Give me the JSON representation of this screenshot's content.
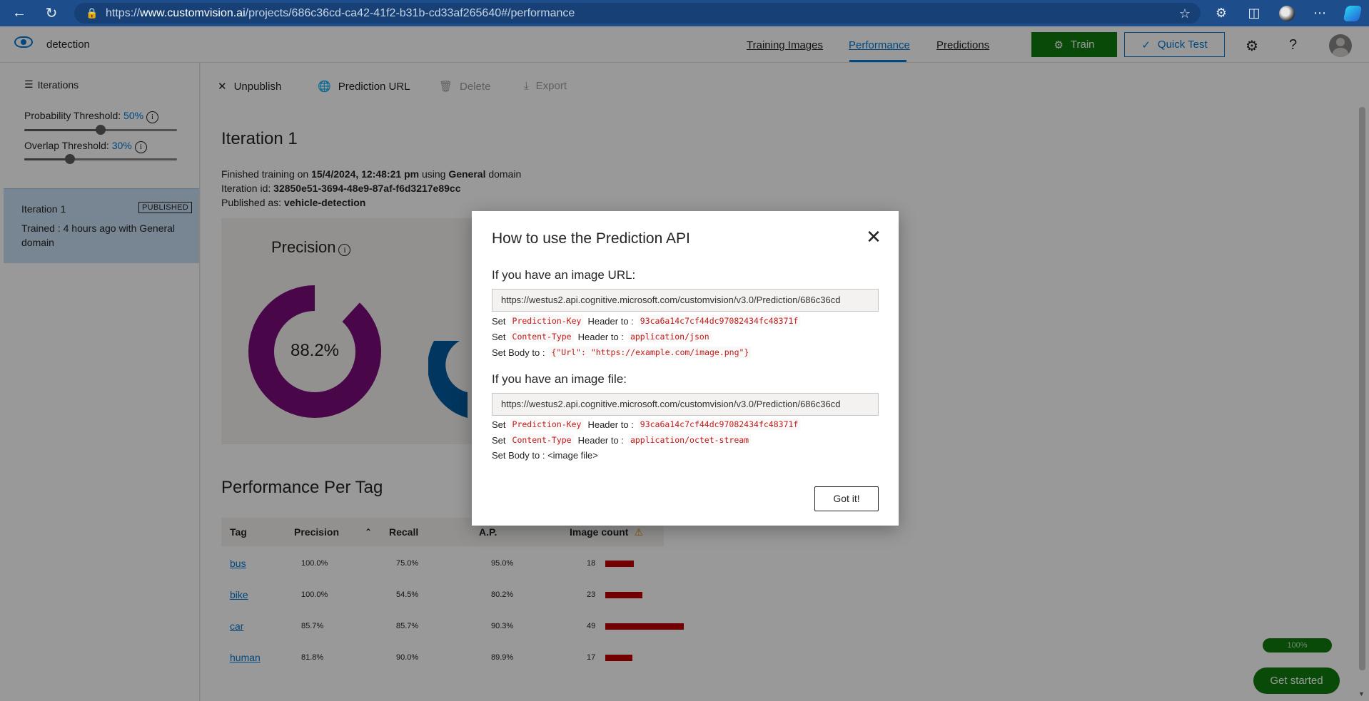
{
  "browser": {
    "url_prefix": "https://",
    "url_host": "www.customvision.ai",
    "url_path": "/projects/686c36cd-ca42-41f2-b31b-cd33af265640#/performance"
  },
  "header": {
    "project_name": "detection",
    "nav": [
      "Training Images",
      "Performance",
      "Predictions"
    ],
    "train_label": "Train",
    "quick_test_label": "Quick Test"
  },
  "sidebar": {
    "iterations_label": "Iterations",
    "probability_label": "Probability Threshold:",
    "probability_value": "50%",
    "probability_level": 0.5,
    "overlap_label": "Overlap Threshold:",
    "overlap_value": "30%",
    "overlap_level": 0.3,
    "iteration": {
      "title": "Iteration 1",
      "badge": "PUBLISHED",
      "desc": "Trained : 4 hours ago with General domain"
    }
  },
  "toolbar": {
    "unpublish": "Unpublish",
    "prediction_url": "Prediction URL",
    "delete": "Delete",
    "export": "Export"
  },
  "main": {
    "title": "Iteration 1",
    "finished_prefix": "Finished training on",
    "finished_date": "15/4/2024, 12:48:21 pm",
    "finished_using": "using",
    "domain": "General",
    "domain_suffix": "domain",
    "iteration_id_label": "Iteration id:",
    "iteration_id": "32850e51-3694-48e9-87af-f6d3217e89cc",
    "published_label": "Published as:",
    "published_name": "vehicle-detection",
    "precision_title": "Precision",
    "precision_value": "88.2%",
    "precision_level": 0.882,
    "perf_title": "Performance Per Tag"
  },
  "table": {
    "headers": [
      "Tag",
      "Precision",
      "Recall",
      "A.P.",
      "Image count"
    ],
    "rows": [
      {
        "tag": "bus",
        "precision": "100.0%",
        "recall": "75.0%",
        "ap": "95.0%",
        "count": "18",
        "count_num": 18
      },
      {
        "tag": "bike",
        "precision": "100.0%",
        "recall": "54.5%",
        "ap": "80.2%",
        "count": "23",
        "count_num": 23
      },
      {
        "tag": "car",
        "precision": "85.7%",
        "recall": "85.7%",
        "ap": "90.3%",
        "count": "49",
        "count_num": 49
      },
      {
        "tag": "human",
        "precision": "81.8%",
        "recall": "90.0%",
        "ap": "89.9%",
        "count": "17",
        "count_num": 17
      }
    ]
  },
  "dialog": {
    "title": "How to use the Prediction API",
    "url_heading": "If you have an image URL:",
    "file_heading": "If you have an image file:",
    "endpoint": "https://westus2.api.cognitive.microsoft.com/customvision/v3.0/Prediction/686c36cd",
    "set": "Set",
    "prediction_key_name": "Prediction-Key",
    "header_to": "Header to :",
    "prediction_key_value": "93ca6a14c7cf44dc97082434fc48371f",
    "content_type_name": "Content-Type",
    "json_type": "application/json",
    "octet_type": "application/octet-stream",
    "set_body": "Set Body to :",
    "body_url": "{\"Url\": \"https://example.com/image.png\"}",
    "body_file": "<image file>",
    "got_it": "Got it!"
  },
  "widget": {
    "progress": "100%",
    "get_started": "Get started"
  },
  "colors": {
    "accent": "#0078d4",
    "train_green": "#107c10",
    "donut_purple": "#7a0a7a",
    "bar_red": "#c00000"
  }
}
